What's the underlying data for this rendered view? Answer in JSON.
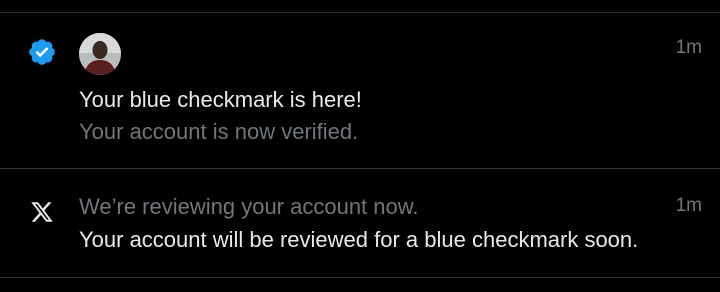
{
  "notifications": [
    {
      "icon": "verified-badge-icon",
      "has_avatar": true,
      "timestamp": "1m",
      "title": "Your blue checkmark is here!",
      "subtitle": "Your account is now verified."
    },
    {
      "icon": "x-logo-icon",
      "has_avatar": false,
      "timestamp": "1m",
      "title": "We’re reviewing your account now.",
      "subtitle": "Your account will be reviewed for a blue checkmark soon."
    }
  ],
  "colors": {
    "background": "#000000",
    "primary_text": "#e7e9ea",
    "secondary_text": "#71767b",
    "divider": "#2f3336",
    "verified_blue": "#1d9bf0"
  }
}
